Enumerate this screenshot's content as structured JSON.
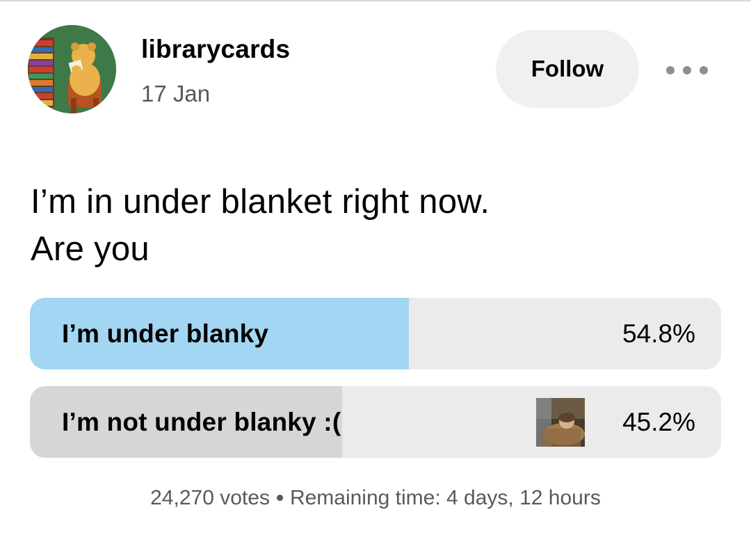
{
  "post": {
    "username": "librarycards",
    "date": "17 Jan",
    "follow_label": "Follow",
    "more_icon": "more-horizontal-icon",
    "avatar_icon": "bear-reading-avatar"
  },
  "poll": {
    "question_line1": "I’m in under blanket right now.",
    "question_line2": "Are you",
    "options": [
      {
        "label": "I’m under blanky",
        "percent_text": "54.8%",
        "percent": 54.8,
        "fill_color": "#a3d6f2"
      },
      {
        "label": "I’m not under blanky :(",
        "percent_text": "45.2%",
        "percent": 45.2,
        "fill_color": "#d6d6d6",
        "thumbnail": "sleeping-under-blanket-thumbnail"
      }
    ],
    "votes": "24,270 votes",
    "remaining": "Remaining time: 4 days, 12 hours"
  },
  "colors": {
    "secondary_text": "#555a60",
    "track": "#ebebeb",
    "button_bg": "#eef0f2"
  }
}
